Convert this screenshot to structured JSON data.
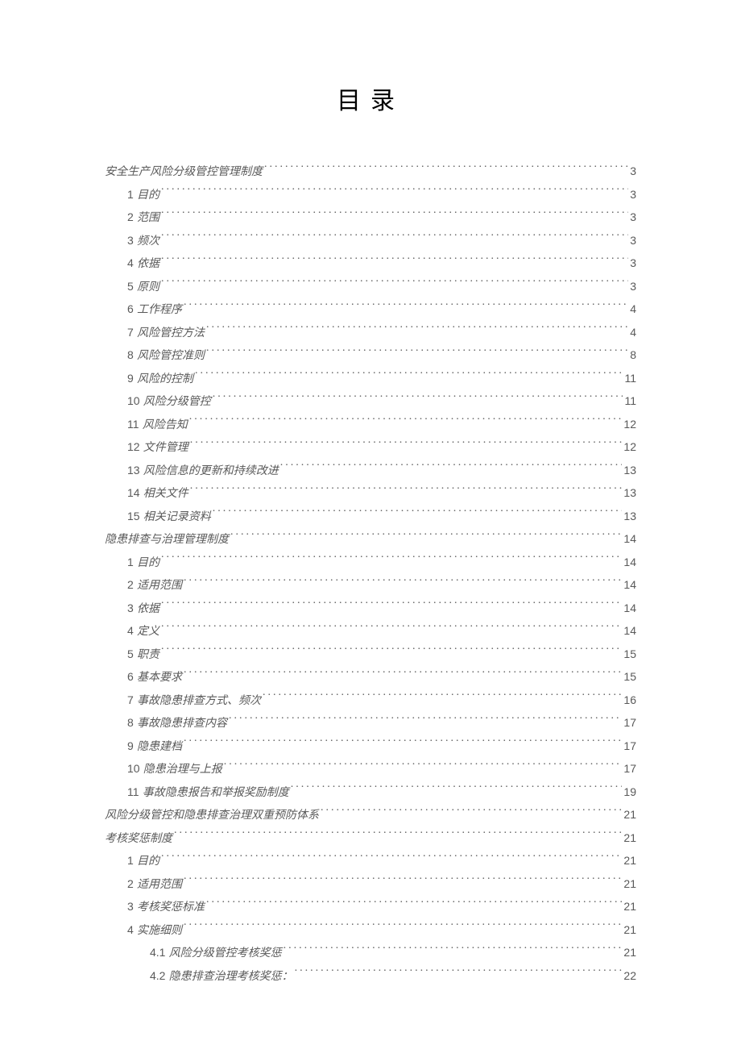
{
  "title": "目录",
  "toc": [
    {
      "level": 0,
      "num": "",
      "text": "安全生产风险分级管控管理制度",
      "page": "3"
    },
    {
      "level": 1,
      "num": "1",
      "text": "目的",
      "page": "3"
    },
    {
      "level": 1,
      "num": "2",
      "text": "范围",
      "page": "3"
    },
    {
      "level": 1,
      "num": "3",
      "text": "频次",
      "page": "3"
    },
    {
      "level": 1,
      "num": "4",
      "text": "依据",
      "page": "3"
    },
    {
      "level": 1,
      "num": "5",
      "text": "原则",
      "page": "3"
    },
    {
      "level": 1,
      "num": "6",
      "text": "工作程序",
      "page": "4"
    },
    {
      "level": 1,
      "num": "7",
      "text": "风险管控方法",
      "page": "4"
    },
    {
      "level": 1,
      "num": "8",
      "text": "风险管控准则",
      "page": "8"
    },
    {
      "level": 1,
      "num": "9",
      "text": "风险的控制",
      "page": "11"
    },
    {
      "level": 1,
      "num": "10",
      "text": "风险分级管控",
      "page": "11"
    },
    {
      "level": 1,
      "num": "11",
      "text": "风险告知",
      "page": "12"
    },
    {
      "level": 1,
      "num": "12",
      "text": "文件管理",
      "page": "12"
    },
    {
      "level": 1,
      "num": "13",
      "text": "风险信息的更新和持续改进",
      "page": "13"
    },
    {
      "level": 1,
      "num": "14",
      "text": "相关文件",
      "page": "13"
    },
    {
      "level": 1,
      "num": "15",
      "text": "相关记录资料",
      "page": "13"
    },
    {
      "level": 0,
      "num": "",
      "text": "隐患排查与治理管理制度",
      "page": "14"
    },
    {
      "level": 1,
      "num": "1",
      "text": "目的",
      "page": "14"
    },
    {
      "level": 1,
      "num": "2",
      "text": "适用范围",
      "page": "14"
    },
    {
      "level": 1,
      "num": "3",
      "text": "依据",
      "page": "14"
    },
    {
      "level": 1,
      "num": "4",
      "text": "定义",
      "page": "14"
    },
    {
      "level": 1,
      "num": "5",
      "text": "职责",
      "page": "15"
    },
    {
      "level": 1,
      "num": "6",
      "text": "基本要求",
      "page": "15"
    },
    {
      "level": 1,
      "num": "7",
      "text": "事故隐患排查方式、频次",
      "page": "16"
    },
    {
      "level": 1,
      "num": "8",
      "text": "事故隐患排查内容",
      "page": "17"
    },
    {
      "level": 1,
      "num": "9",
      "text": "隐患建档",
      "page": "17"
    },
    {
      "level": 1,
      "num": "10",
      "text": "隐患治理与上报",
      "page": "17"
    },
    {
      "level": 1,
      "num": "11",
      "text": "事故隐患报告和举报奖励制度",
      "page": "19"
    },
    {
      "level": 0,
      "num": "",
      "text": "风险分级管控和隐患排查治理双重预防体系",
      "page": "21"
    },
    {
      "level": 0,
      "num": "",
      "text": "考核奖惩制度",
      "page": "21"
    },
    {
      "level": 1,
      "num": "1",
      "text": "目的",
      "page": "21"
    },
    {
      "level": 1,
      "num": "2",
      "text": "适用范围",
      "page": "21"
    },
    {
      "level": 1,
      "num": "3",
      "text": "考核奖惩标准",
      "page": "21"
    },
    {
      "level": 1,
      "num": "4",
      "text": "实施细则",
      "page": "21"
    },
    {
      "level": 2,
      "num": "4.1",
      "text": "风险分级管控考核奖惩",
      "page": "21"
    },
    {
      "level": 2,
      "num": "4.2",
      "text": "隐患排查治理考核奖惩：",
      "page": "22"
    }
  ]
}
